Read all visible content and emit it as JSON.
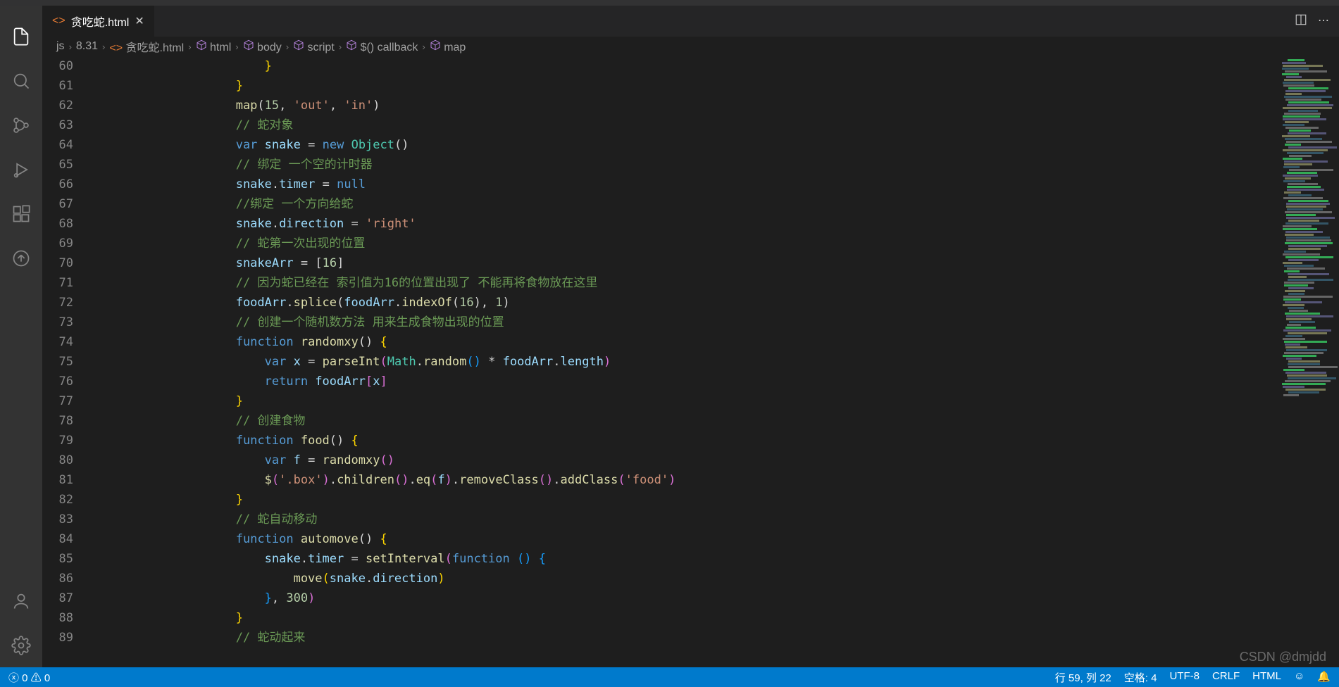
{
  "tab": {
    "filename": "贪吃蛇.html",
    "icon": "code-file-icon"
  },
  "breadcrumb": [
    {
      "label": "js",
      "icon": ""
    },
    {
      "label": "8.31",
      "icon": ""
    },
    {
      "label": "贪吃蛇.html",
      "icon": "code-file"
    },
    {
      "label": "html",
      "icon": "cube"
    },
    {
      "label": "body",
      "icon": "cube"
    },
    {
      "label": "script",
      "icon": "cube"
    },
    {
      "label": "$() callback",
      "icon": "cube"
    },
    {
      "label": "map",
      "icon": "cube"
    }
  ],
  "lines": [
    {
      "n": 60,
      "i": 6,
      "t": [
        {
          "c": "tk-brace",
          "v": "}"
        }
      ]
    },
    {
      "n": 61,
      "i": 5,
      "t": [
        {
          "c": "tk-brace",
          "v": "}"
        }
      ]
    },
    {
      "n": 62,
      "i": 5,
      "t": [
        {
          "c": "tk-fn",
          "v": "map"
        },
        {
          "c": "tk-pun",
          "v": "("
        },
        {
          "c": "tk-num",
          "v": "15"
        },
        {
          "c": "tk-pun",
          "v": ", "
        },
        {
          "c": "tk-str",
          "v": "'out'"
        },
        {
          "c": "tk-pun",
          "v": ", "
        },
        {
          "c": "tk-str",
          "v": "'in'"
        },
        {
          "c": "tk-pun",
          "v": ")"
        }
      ]
    },
    {
      "n": 63,
      "i": 5,
      "t": [
        {
          "c": "tk-cmt",
          "v": "// 蛇对象"
        }
      ]
    },
    {
      "n": 64,
      "i": 5,
      "t": [
        {
          "c": "tk-kw",
          "v": "var"
        },
        {
          "c": "",
          "v": " "
        },
        {
          "c": "tk-var",
          "v": "snake"
        },
        {
          "c": "",
          "v": " "
        },
        {
          "c": "tk-pun",
          "v": "="
        },
        {
          "c": "",
          "v": " "
        },
        {
          "c": "tk-kw",
          "v": "new"
        },
        {
          "c": "",
          "v": " "
        },
        {
          "c": "tk-cls",
          "v": "Object"
        },
        {
          "c": "tk-pun",
          "v": "()"
        }
      ]
    },
    {
      "n": 65,
      "i": 5,
      "t": [
        {
          "c": "tk-cmt",
          "v": "// 绑定 一个空的计时器"
        }
      ]
    },
    {
      "n": 66,
      "i": 5,
      "t": [
        {
          "c": "tk-var",
          "v": "snake"
        },
        {
          "c": "tk-pun",
          "v": "."
        },
        {
          "c": "tk-var",
          "v": "timer"
        },
        {
          "c": "",
          "v": " "
        },
        {
          "c": "tk-pun",
          "v": "="
        },
        {
          "c": "",
          "v": " "
        },
        {
          "c": "tk-const",
          "v": "null"
        }
      ]
    },
    {
      "n": 67,
      "i": 5,
      "t": [
        {
          "c": "tk-cmt",
          "v": "//绑定 一个方向给蛇"
        }
      ]
    },
    {
      "n": 68,
      "i": 5,
      "t": [
        {
          "c": "tk-var",
          "v": "snake"
        },
        {
          "c": "tk-pun",
          "v": "."
        },
        {
          "c": "tk-var",
          "v": "direction"
        },
        {
          "c": "",
          "v": " "
        },
        {
          "c": "tk-pun",
          "v": "="
        },
        {
          "c": "",
          "v": " "
        },
        {
          "c": "tk-str",
          "v": "'right'"
        }
      ]
    },
    {
      "n": 69,
      "i": 5,
      "t": [
        {
          "c": "tk-cmt",
          "v": "// 蛇第一次出现的位置"
        }
      ]
    },
    {
      "n": 70,
      "i": 5,
      "t": [
        {
          "c": "tk-var",
          "v": "snakeArr"
        },
        {
          "c": "",
          "v": " "
        },
        {
          "c": "tk-pun",
          "v": "="
        },
        {
          "c": "",
          "v": " "
        },
        {
          "c": "tk-pun",
          "v": "["
        },
        {
          "c": "tk-num",
          "v": "16"
        },
        {
          "c": "tk-pun",
          "v": "]"
        }
      ]
    },
    {
      "n": 71,
      "i": 5,
      "t": [
        {
          "c": "tk-cmt",
          "v": "// 因为蛇已经在 索引值为16的位置出现了 不能再将食物放在这里"
        }
      ]
    },
    {
      "n": 72,
      "i": 5,
      "t": [
        {
          "c": "tk-var",
          "v": "foodArr"
        },
        {
          "c": "tk-pun",
          "v": "."
        },
        {
          "c": "tk-fn",
          "v": "splice"
        },
        {
          "c": "tk-pun",
          "v": "("
        },
        {
          "c": "tk-var",
          "v": "foodArr"
        },
        {
          "c": "tk-pun",
          "v": "."
        },
        {
          "c": "tk-fn",
          "v": "indexOf"
        },
        {
          "c": "tk-pun",
          "v": "("
        },
        {
          "c": "tk-num",
          "v": "16"
        },
        {
          "c": "tk-pun",
          "v": "), "
        },
        {
          "c": "tk-num",
          "v": "1"
        },
        {
          "c": "tk-pun",
          "v": ")"
        }
      ]
    },
    {
      "n": 73,
      "i": 5,
      "t": [
        {
          "c": "tk-cmt",
          "v": "// 创建一个随机数方法 用来生成食物出现的位置"
        }
      ]
    },
    {
      "n": 74,
      "i": 5,
      "t": [
        {
          "c": "tk-kw",
          "v": "function"
        },
        {
          "c": "",
          "v": " "
        },
        {
          "c": "tk-fn",
          "v": "randomxy"
        },
        {
          "c": "tk-pun",
          "v": "() "
        },
        {
          "c": "tk-brace",
          "v": "{"
        }
      ]
    },
    {
      "n": 75,
      "i": 6,
      "t": [
        {
          "c": "tk-kw",
          "v": "var"
        },
        {
          "c": "",
          "v": " "
        },
        {
          "c": "tk-var",
          "v": "x"
        },
        {
          "c": "",
          "v": " "
        },
        {
          "c": "tk-pun",
          "v": "="
        },
        {
          "c": "",
          "v": " "
        },
        {
          "c": "tk-fn",
          "v": "parseInt"
        },
        {
          "c": "tk-brace2",
          "v": "("
        },
        {
          "c": "tk-cls",
          "v": "Math"
        },
        {
          "c": "tk-pun",
          "v": "."
        },
        {
          "c": "tk-fn",
          "v": "random"
        },
        {
          "c": "tk-brace3",
          "v": "()"
        },
        {
          "c": "",
          "v": " "
        },
        {
          "c": "tk-pun",
          "v": "*"
        },
        {
          "c": "",
          "v": " "
        },
        {
          "c": "tk-var",
          "v": "foodArr"
        },
        {
          "c": "tk-pun",
          "v": "."
        },
        {
          "c": "tk-var",
          "v": "length"
        },
        {
          "c": "tk-brace2",
          "v": ")"
        }
      ]
    },
    {
      "n": 76,
      "i": 6,
      "t": [
        {
          "c": "tk-kw",
          "v": "return"
        },
        {
          "c": "",
          "v": " "
        },
        {
          "c": "tk-var",
          "v": "foodArr"
        },
        {
          "c": "tk-brace2",
          "v": "["
        },
        {
          "c": "tk-var",
          "v": "x"
        },
        {
          "c": "tk-brace2",
          "v": "]"
        }
      ]
    },
    {
      "n": 77,
      "i": 5,
      "t": [
        {
          "c": "tk-brace",
          "v": "}"
        }
      ]
    },
    {
      "n": 78,
      "i": 5,
      "t": [
        {
          "c": "tk-cmt",
          "v": "// 创建食物"
        }
      ]
    },
    {
      "n": 79,
      "i": 5,
      "t": [
        {
          "c": "tk-kw",
          "v": "function"
        },
        {
          "c": "",
          "v": " "
        },
        {
          "c": "tk-fn",
          "v": "food"
        },
        {
          "c": "tk-pun",
          "v": "() "
        },
        {
          "c": "tk-brace",
          "v": "{"
        }
      ]
    },
    {
      "n": 80,
      "i": 6,
      "t": [
        {
          "c": "tk-kw",
          "v": "var"
        },
        {
          "c": "",
          "v": " "
        },
        {
          "c": "tk-var",
          "v": "f"
        },
        {
          "c": "",
          "v": " "
        },
        {
          "c": "tk-pun",
          "v": "="
        },
        {
          "c": "",
          "v": " "
        },
        {
          "c": "tk-fn",
          "v": "randomxy"
        },
        {
          "c": "tk-brace2",
          "v": "()"
        }
      ]
    },
    {
      "n": 81,
      "i": 6,
      "t": [
        {
          "c": "tk-fn",
          "v": "$"
        },
        {
          "c": "tk-brace2",
          "v": "("
        },
        {
          "c": "tk-str",
          "v": "'.box'"
        },
        {
          "c": "tk-brace2",
          "v": ")"
        },
        {
          "c": "tk-pun",
          "v": "."
        },
        {
          "c": "tk-fn",
          "v": "children"
        },
        {
          "c": "tk-brace2",
          "v": "()"
        },
        {
          "c": "tk-pun",
          "v": "."
        },
        {
          "c": "tk-fn",
          "v": "eq"
        },
        {
          "c": "tk-brace2",
          "v": "("
        },
        {
          "c": "tk-var",
          "v": "f"
        },
        {
          "c": "tk-brace2",
          "v": ")"
        },
        {
          "c": "tk-pun",
          "v": "."
        },
        {
          "c": "tk-fn",
          "v": "removeClass"
        },
        {
          "c": "tk-brace2",
          "v": "()"
        },
        {
          "c": "tk-pun",
          "v": "."
        },
        {
          "c": "tk-fn",
          "v": "addClass"
        },
        {
          "c": "tk-brace2",
          "v": "("
        },
        {
          "c": "tk-str",
          "v": "'food'"
        },
        {
          "c": "tk-brace2",
          "v": ")"
        }
      ]
    },
    {
      "n": 82,
      "i": 5,
      "t": [
        {
          "c": "tk-brace",
          "v": "}"
        }
      ]
    },
    {
      "n": 83,
      "i": 5,
      "t": [
        {
          "c": "tk-cmt",
          "v": "// 蛇自动移动"
        }
      ]
    },
    {
      "n": 84,
      "i": 5,
      "t": [
        {
          "c": "tk-kw",
          "v": "function"
        },
        {
          "c": "",
          "v": " "
        },
        {
          "c": "tk-fn",
          "v": "automove"
        },
        {
          "c": "tk-pun",
          "v": "() "
        },
        {
          "c": "tk-brace",
          "v": "{"
        }
      ]
    },
    {
      "n": 85,
      "i": 6,
      "t": [
        {
          "c": "tk-var",
          "v": "snake"
        },
        {
          "c": "tk-pun",
          "v": "."
        },
        {
          "c": "tk-var",
          "v": "timer"
        },
        {
          "c": "",
          "v": " "
        },
        {
          "c": "tk-pun",
          "v": "="
        },
        {
          "c": "",
          "v": " "
        },
        {
          "c": "tk-fn",
          "v": "setInterval"
        },
        {
          "c": "tk-brace2",
          "v": "("
        },
        {
          "c": "tk-kw",
          "v": "function"
        },
        {
          "c": "",
          "v": " "
        },
        {
          "c": "tk-brace3",
          "v": "()"
        },
        {
          "c": "",
          "v": " "
        },
        {
          "c": "tk-brace3",
          "v": "{"
        }
      ]
    },
    {
      "n": 86,
      "i": 7,
      "t": [
        {
          "c": "tk-fn",
          "v": "move"
        },
        {
          "c": "tk-brace",
          "v": "("
        },
        {
          "c": "tk-var",
          "v": "snake"
        },
        {
          "c": "tk-pun",
          "v": "."
        },
        {
          "c": "tk-var",
          "v": "direction"
        },
        {
          "c": "tk-brace",
          "v": ")"
        }
      ]
    },
    {
      "n": 87,
      "i": 6,
      "t": [
        {
          "c": "tk-brace3",
          "v": "}"
        },
        {
          "c": "tk-pun",
          "v": ", "
        },
        {
          "c": "tk-num",
          "v": "300"
        },
        {
          "c": "tk-brace2",
          "v": ")"
        }
      ]
    },
    {
      "n": 88,
      "i": 5,
      "t": [
        {
          "c": "tk-brace",
          "v": "}"
        }
      ]
    },
    {
      "n": 89,
      "i": 5,
      "t": [
        {
          "c": "tk-cmt",
          "v": "// 蛇动起来"
        }
      ]
    }
  ],
  "status": {
    "errors": "0",
    "warnings": "0",
    "line": "行 59",
    "col": "列 22",
    "spaces": "空格: 4",
    "encoding": "UTF-8",
    "eol": "CRLF",
    "lang": "HTML"
  },
  "watermark": "CSDN @dmjdd"
}
